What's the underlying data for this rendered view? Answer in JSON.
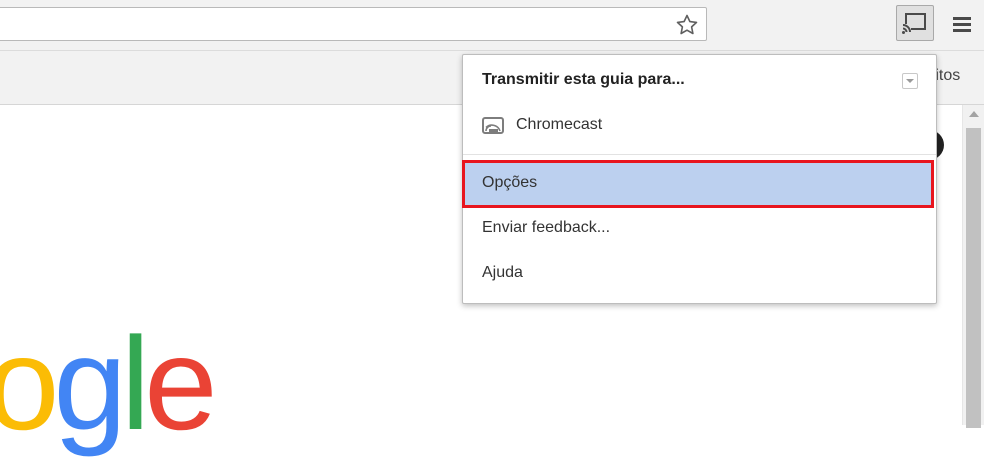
{
  "toolbar": {
    "star_icon": "star-icon",
    "cast_icon": "cast-icon",
    "menu_icon": "hamburger-menu-icon"
  },
  "bookmarks": {
    "partial_label": "ritos"
  },
  "logo": {
    "letters": [
      {
        "char": "o",
        "color": "#fbbc05"
      },
      {
        "char": "g",
        "color": "#4285f4"
      },
      {
        "char": "l",
        "color": "#34a853"
      },
      {
        "char": "e",
        "color": "#ea4335"
      }
    ]
  },
  "popup": {
    "title": "Transmitir esta guia para...",
    "device": "Chromecast",
    "items": {
      "options": "Opções",
      "feedback": "Enviar feedback...",
      "help": "Ajuda"
    },
    "highlight_color": "#bcd0ef",
    "annotation_color": "#e8151e"
  }
}
